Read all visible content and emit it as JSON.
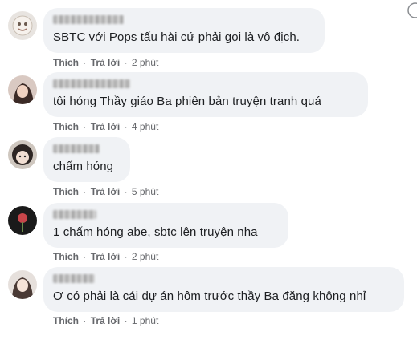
{
  "actions": {
    "like_label": "Thích",
    "reply_label": "Trả lời",
    "separator": "·"
  },
  "comments": [
    {
      "text": "SBTC với Pops tấu hài cứ phải gọi là vô địch.",
      "time": "2 phút"
    },
    {
      "text": "tôi hóng Thầy giáo Ba phiên bản truyện tranh quá",
      "time": "4 phút"
    },
    {
      "text": "chấm hóng",
      "time": "5 phút"
    },
    {
      "text": "1 chấm hóng abe, sbtc lên truyện nha",
      "time": "2 phút"
    },
    {
      "text": "Ơ có phải là cái dự án hôm trước thầy Ba đăng không nhỉ",
      "time": "1 phút"
    }
  ],
  "icons": [
    "avatar",
    "options-icon"
  ]
}
